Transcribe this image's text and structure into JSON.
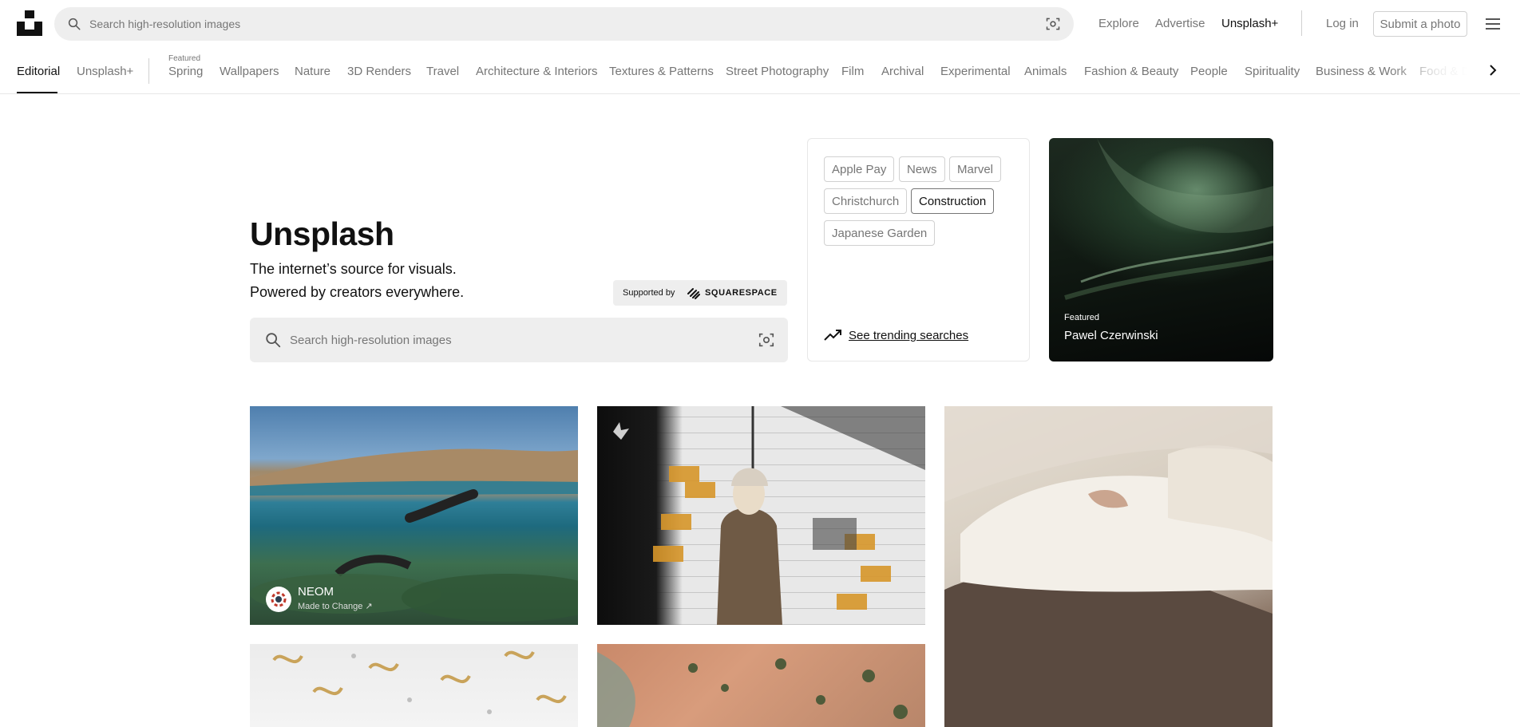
{
  "header": {
    "search_placeholder": "Search high-resolution images",
    "nav": {
      "explore": "Explore",
      "advertise": "Advertise",
      "unsplash_plus": "Unsplash+"
    },
    "login": "Log in",
    "submit": "Submit a photo"
  },
  "topics": {
    "editorial": "Editorial",
    "unsplash_plus": "Unsplash+",
    "featured_label": "Featured",
    "items": [
      "Spring",
      "Wallpapers",
      "Nature",
      "3D Renders",
      "Travel",
      "Architecture & Interiors",
      "Textures & Patterns",
      "Street Photography",
      "Film",
      "Archival",
      "Experimental",
      "Animals",
      "Fashion & Beauty",
      "People",
      "Spirituality",
      "Business & Work",
      "Food & Drink"
    ]
  },
  "hero": {
    "title": "Unsplash",
    "line1": "The internet’s source for visuals.",
    "line2": "Powered by creators everywhere.",
    "supported_by": "Supported by",
    "sponsor_name": "SQUARESPACE",
    "search_placeholder": "Search high-resolution images"
  },
  "trending": {
    "chips": [
      "Apple Pay",
      "News",
      "Marvel",
      "Christchurch",
      "Construction",
      "Japanese Garden"
    ],
    "link": "See trending searches"
  },
  "featured": {
    "label": "Featured",
    "name": "Pawel Czerwinski"
  },
  "photos": {
    "sponsor": {
      "name": "NEOM",
      "tagline": "Made to Change ↗"
    }
  },
  "colors": {
    "accent": "#111111",
    "muted": "#767676",
    "search_bg": "#eeeeee",
    "border": "#d1d1d1"
  }
}
